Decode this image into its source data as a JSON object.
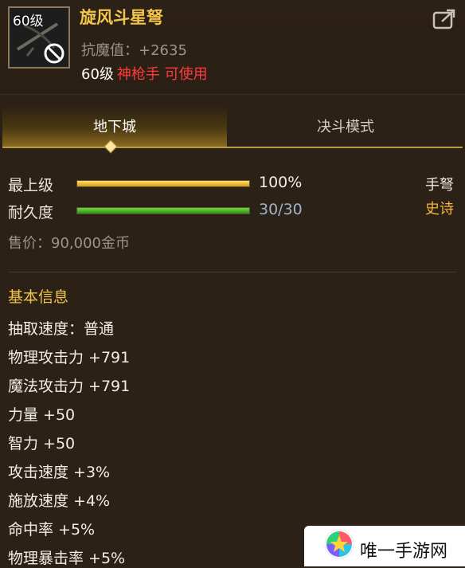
{
  "item": {
    "level_badge": "60级",
    "name": "旋风斗星弩",
    "anti_magic": "抗魔值：+2635",
    "req_level": "60级",
    "req_class": "神枪手 可使用"
  },
  "tabs": [
    {
      "label": "地下城",
      "active": true
    },
    {
      "label": "决斗模式",
      "active": false
    }
  ],
  "stats": {
    "upgrade_label": "最上级",
    "upgrade_value": "100%",
    "upgrade_fraction": 1.0,
    "durability_label": "耐久度",
    "durability_value": "30/30",
    "durability_fraction": 1.0,
    "weapon_type": "手弩",
    "rarity": "史诗",
    "price": "售价：90,000金币"
  },
  "basic_info": {
    "title": "基本信息",
    "lines": [
      "抽取速度：普通",
      "物理攻击力 +791",
      "魔法攻击力 +791",
      "力量 +50",
      "智力 +50",
      "攻击速度 +3%",
      "施放速度 +4%",
      "命中率 +5%",
      "物理暴击率 +5%"
    ]
  },
  "watermark": {
    "text": "唯一手游网"
  },
  "colors": {
    "title_gold": "#f3c54a",
    "warning_red": "#ff3b3b",
    "rarity_orange": "#f4b53a",
    "durability_green": "#4cc026"
  },
  "icons": {
    "item": "crossbow-icon",
    "forbidden": "prohibited-icon",
    "share": "share-icon"
  }
}
